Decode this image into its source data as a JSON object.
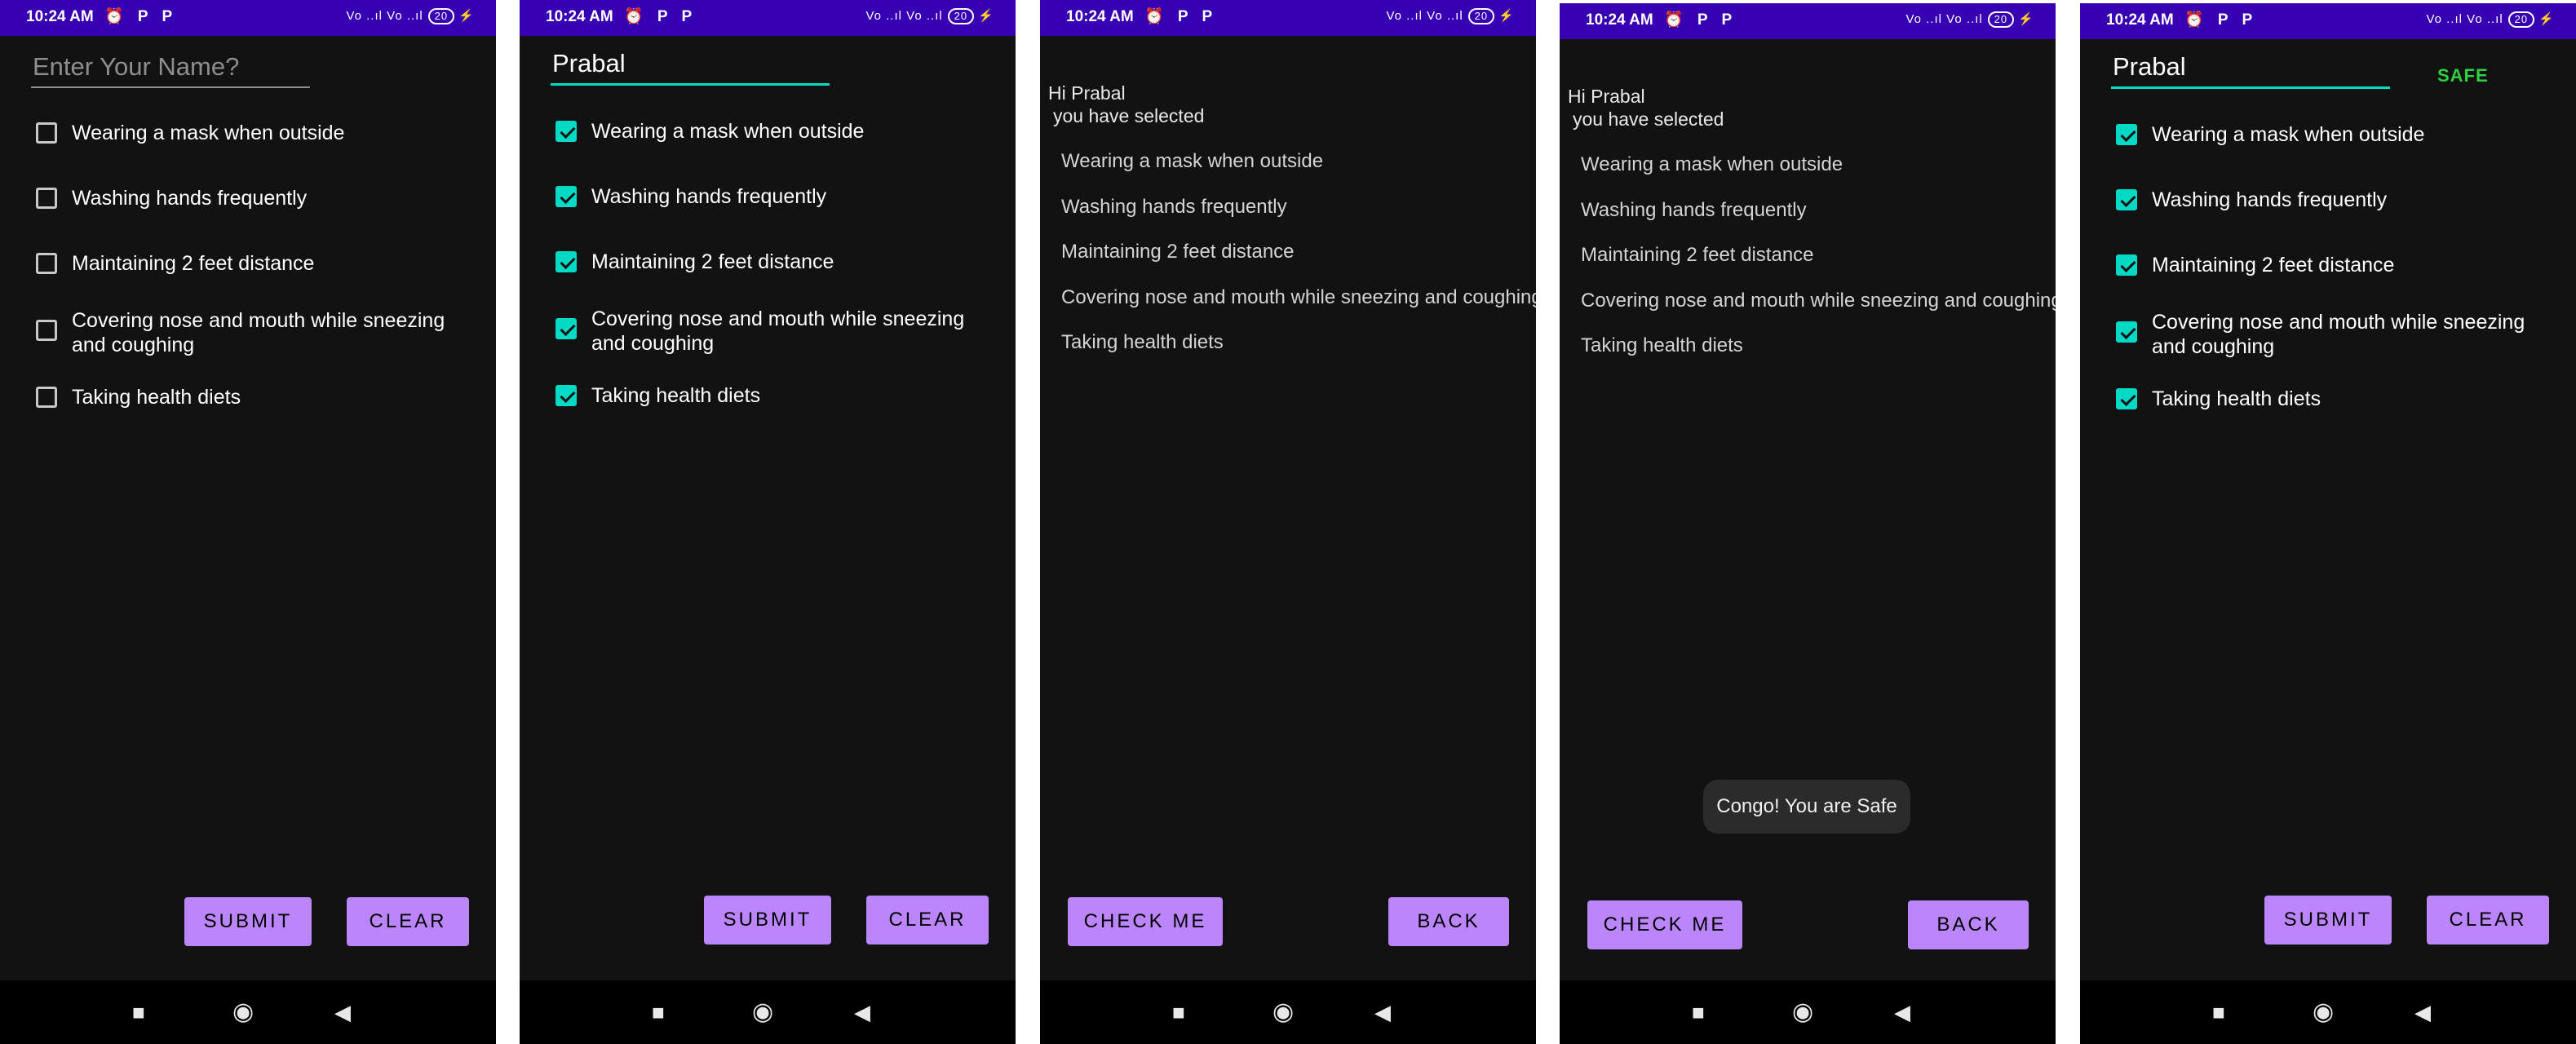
{
  "status_bar": {
    "time": "10:24 AM",
    "icons": "⏰ P P",
    "right": "Vo ..ıl Vo ..ıl",
    "battery": "20"
  },
  "nav_icons": {
    "recents": "■",
    "home": "◉",
    "back": "◀"
  },
  "icon_names": {
    "alarm": "alarm-icon",
    "parking": "parking-icon",
    "signal": "signal-icon",
    "battery": "battery-icon"
  },
  "colors": {
    "status_bar": "#3700b3",
    "accent": "#03dac5",
    "button": "#bb86fc",
    "background": "#121212",
    "safe": "#2ed240"
  },
  "form": {
    "name_placeholder": "Enter Your Name?",
    "items": [
      "Wearing a mask when outside",
      "Washing hands frequently",
      "Maintaining 2 feet distance",
      "Covering nose and mouth while sneezing and coughing",
      "Taking health diets"
    ],
    "submit_label": "SUBMIT",
    "clear_label": "CLEAR"
  },
  "screens": [
    {
      "name_value": "",
      "checked": [
        false,
        false,
        false,
        false,
        false
      ]
    },
    {
      "name_value": "Prabal",
      "checked": [
        true,
        true,
        true,
        true,
        true
      ]
    },
    {
      "greeting": "Hi Prabal",
      "subheading": "you have selected"
    },
    {
      "greeting": "Hi Prabal",
      "subheading": "you have selected",
      "toast": "Congo! You are Safe"
    },
    {
      "name_value": "Prabal",
      "checked": [
        true,
        true,
        true,
        true,
        true
      ],
      "result": "SAFE"
    }
  ],
  "result_screen": {
    "check_label": "CHECK ME",
    "back_label": "BACK"
  }
}
